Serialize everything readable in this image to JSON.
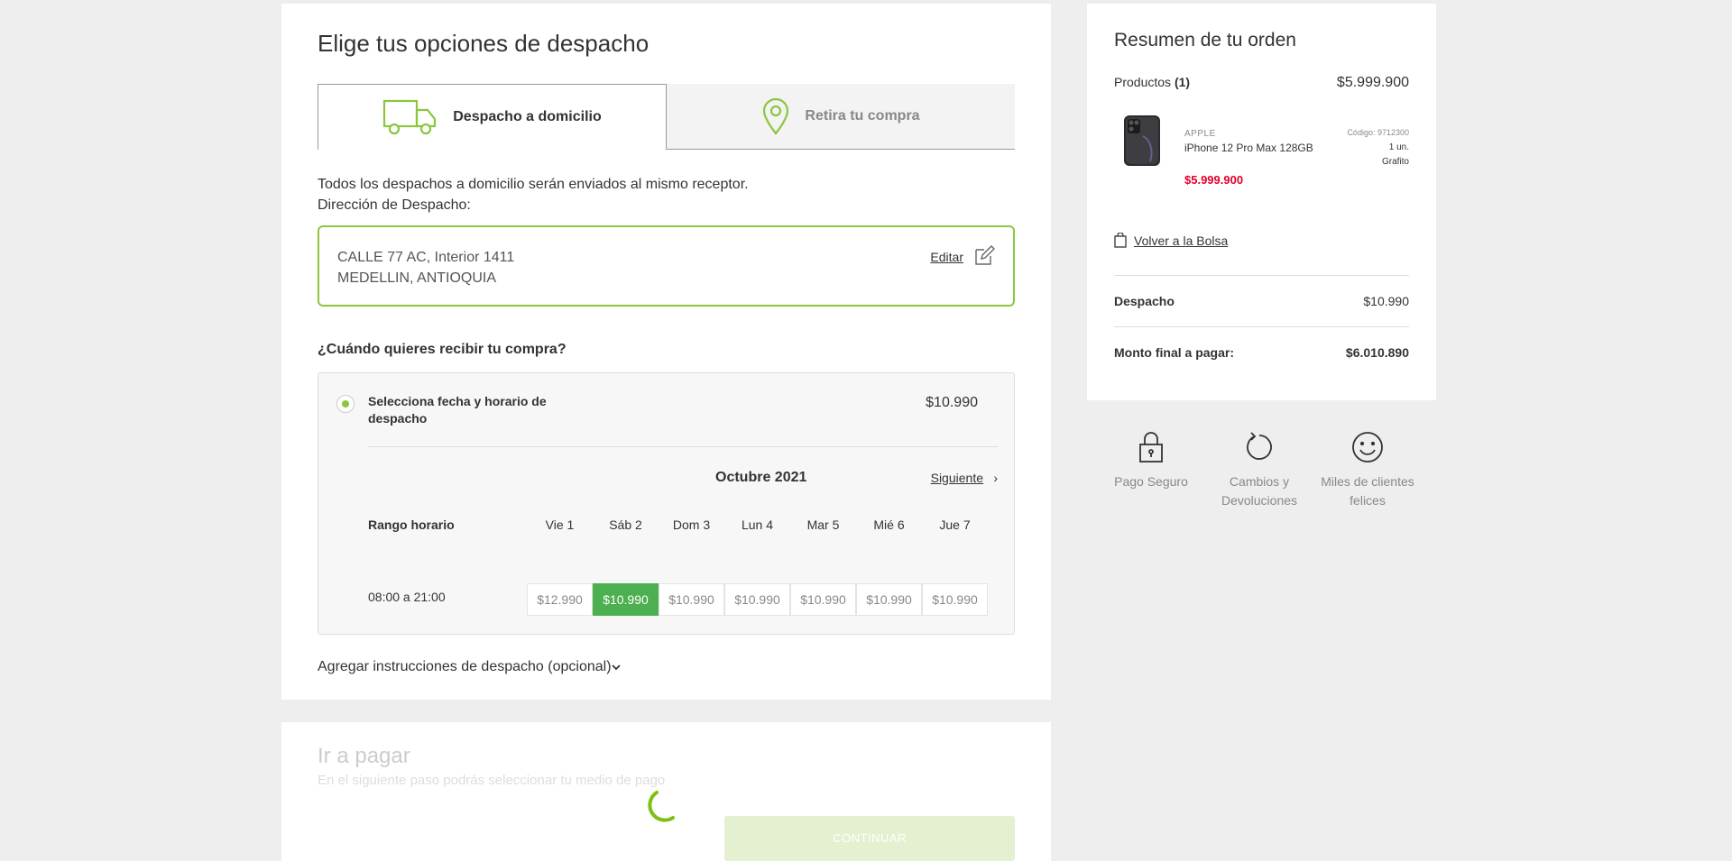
{
  "shipping": {
    "title": "Elige tus opciones de despacho",
    "tabs": {
      "home": "Despacho a domicilio",
      "store": "Retira tu compra"
    },
    "info_line1": "Todos los despachos a domicilio serán enviados al mismo receptor.",
    "info_line2": "Dirección de Despacho:",
    "address": {
      "line1": "CALLE 77 AC, Interior 1411",
      "line2": "MEDELLIN, ANTIOQUIA",
      "edit_label": "Editar"
    },
    "question": "¿Cuándo quieres recibir tu compra?",
    "option": {
      "label": "Selecciona fecha y horario de despacho",
      "price": "$10.990"
    },
    "calendar": {
      "month": "Octubre 2021",
      "next_label": "Siguiente",
      "range_label": "Rango horario",
      "days": [
        "Vie 1",
        "Sáb 2",
        "Dom 3",
        "Lun 4",
        "Mar 5",
        "Mié 6",
        "Jue 7"
      ],
      "hours": "08:00 a 21:00",
      "prices": [
        "$12.990",
        "$10.990",
        "$10.990",
        "$10.990",
        "$10.990",
        "$10.990",
        "$10.990"
      ],
      "selected_index": 1
    },
    "instructions": "Agregar instrucciones de despacho (opcional)"
  },
  "payment": {
    "title": "Ir a pagar",
    "subtitle": "En el siguiente paso podrás seleccionar tu medio de pago",
    "continue_label": "CONTINUAR"
  },
  "summary": {
    "title": "Resumen de tu orden",
    "products_label": "Productos",
    "products_count": "(1)",
    "products_total": "$5.999.900",
    "product": {
      "brand": "APPLE",
      "name": "iPhone 12 Pro Max 128GB",
      "price": "$5.999.900",
      "code": "Código: 9712300",
      "qty": "1 un.",
      "color": "Grafito"
    },
    "back_label": "Volver a la Bolsa",
    "shipping_label": "Despacho",
    "shipping_value": "$10.990",
    "total_label": "Monto final a pagar:",
    "total_value": "$6.010.890"
  },
  "trust": [
    {
      "icon": "lock-icon",
      "label": "Pago Seguro"
    },
    {
      "icon": "return-icon",
      "label": "Cambios y Devoluciones"
    },
    {
      "icon": "smile-icon",
      "label": "Miles de clientes felices"
    }
  ],
  "colors": {
    "accent": "#8cc63f",
    "selected": "#4caf50",
    "price_red": "#e4002b"
  }
}
